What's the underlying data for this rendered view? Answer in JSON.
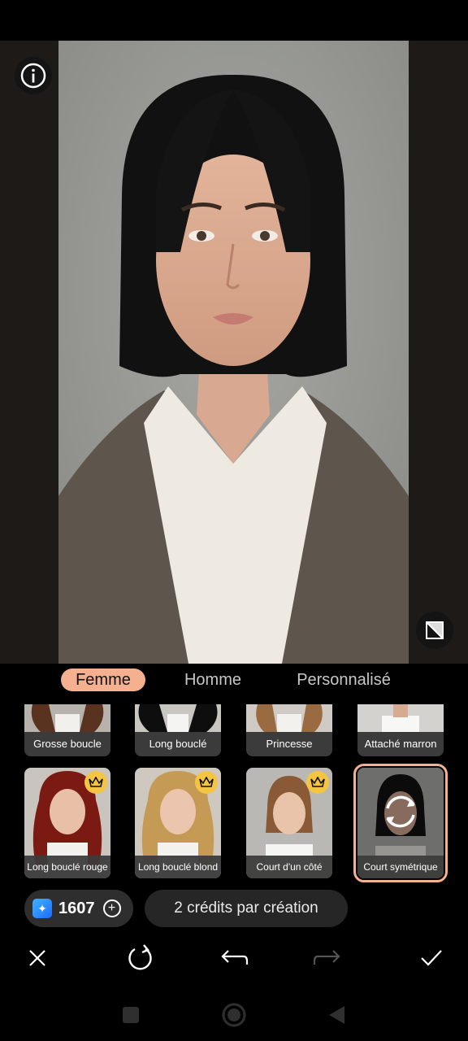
{
  "tabs": [
    {
      "label": "Femme",
      "active": true
    },
    {
      "label": "Homme",
      "active": false
    },
    {
      "label": "Personnalisé",
      "active": false
    }
  ],
  "styles_row_top": [
    {
      "label": "Grosse boucle"
    },
    {
      "label": "Long bouclé"
    },
    {
      "label": "Princesse"
    },
    {
      "label": "Attaché marron"
    }
  ],
  "styles_row_main": [
    {
      "label": "Long bouclé rouge",
      "premium": true
    },
    {
      "label": "Long bouclé blond",
      "premium": true
    },
    {
      "label": "Court d'un côté",
      "premium": true
    },
    {
      "label": "Court symétrique",
      "premium": false,
      "selected": true
    }
  ],
  "credits": {
    "count": "1607",
    "note": "2 crédits par création"
  },
  "toolbar": {
    "close": "close-icon",
    "regenerate": "refresh-icon",
    "undo": "undo-icon",
    "redo": "redo-icon",
    "confirm": "check-icon"
  },
  "colors": {
    "accent": "#f5b08f",
    "premium": "#f4c542"
  }
}
